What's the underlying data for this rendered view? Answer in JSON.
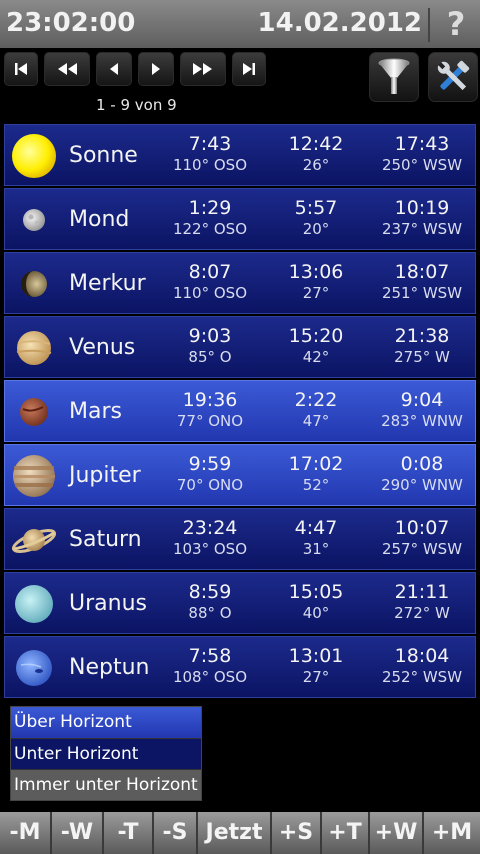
{
  "header": {
    "time": "23:02:00",
    "date": "14.02.2012",
    "help": "?"
  },
  "nav": {
    "page_info": "1 - 9 von 9"
  },
  "rows": [
    {
      "name": "Sonne",
      "rise_time": "7:43",
      "rise_az": "110° OSO",
      "transit_time": "12:42",
      "transit_alt": "26°",
      "set_time": "17:43",
      "set_az": "250° WSW",
      "state": "below"
    },
    {
      "name": "Mond",
      "rise_time": "1:29",
      "rise_az": "122° OSO",
      "transit_time": "5:57",
      "transit_alt": "20°",
      "set_time": "10:19",
      "set_az": "237° WSW",
      "state": "below"
    },
    {
      "name": "Merkur",
      "rise_time": "8:07",
      "rise_az": "110° OSO",
      "transit_time": "13:06",
      "transit_alt": "27°",
      "set_time": "18:07",
      "set_az": "251° WSW",
      "state": "below"
    },
    {
      "name": "Venus",
      "rise_time": "9:03",
      "rise_az": "85° O",
      "transit_time": "15:20",
      "transit_alt": "42°",
      "set_time": "21:38",
      "set_az": "275° W",
      "state": "below"
    },
    {
      "name": "Mars",
      "rise_time": "19:36",
      "rise_az": "77° ONO",
      "transit_time": "2:22",
      "transit_alt": "47°",
      "set_time": "9:04",
      "set_az": "283° WNW",
      "state": "above"
    },
    {
      "name": "Jupiter",
      "rise_time": "9:59",
      "rise_az": "70° ONO",
      "transit_time": "17:02",
      "transit_alt": "52°",
      "set_time": "0:08",
      "set_az": "290° WNW",
      "state": "above"
    },
    {
      "name": "Saturn",
      "rise_time": "23:24",
      "rise_az": "103° OSO",
      "transit_time": "4:47",
      "transit_alt": "31°",
      "set_time": "10:07",
      "set_az": "257° WSW",
      "state": "below"
    },
    {
      "name": "Uranus",
      "rise_time": "8:59",
      "rise_az": "88° O",
      "transit_time": "15:05",
      "transit_alt": "40°",
      "set_time": "21:11",
      "set_az": "272° W",
      "state": "below"
    },
    {
      "name": "Neptun",
      "rise_time": "7:58",
      "rise_az": "108° OSO",
      "transit_time": "13:01",
      "transit_alt": "27°",
      "set_time": "18:04",
      "set_az": "252° WSW",
      "state": "below"
    }
  ],
  "legend": {
    "above": "Über Horizont",
    "below": "Unter Horizont",
    "never": "Immer unter Horizont"
  },
  "bottom_buttons": [
    "-M",
    "-W",
    "-T",
    "-S",
    "Jetzt",
    "+S",
    "+T",
    "+W",
    "+M"
  ],
  "colors": {
    "row_above": "#2f48c8",
    "row_below": "#0f1a72",
    "never": "#5c5c5c"
  }
}
